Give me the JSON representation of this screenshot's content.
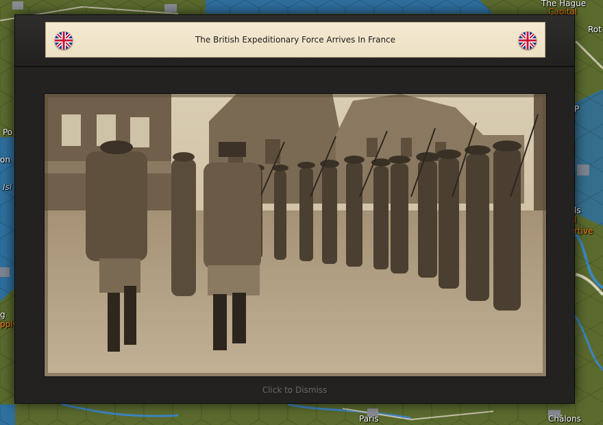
{
  "event_dialog": {
    "title": "The British Expeditionary Force Arrives In France",
    "flag_left_icon": "uk-flag-icon",
    "flag_right_icon": "uk-flag-icon",
    "photo_subject": "historical-photo-icon",
    "dismiss_label": "Click to Dismiss"
  },
  "map": {
    "labels": {
      "the_hague": "The Hague",
      "capital": "Capital",
      "rot": "Rot",
      "p_right": "P",
      "po_left": "Po",
      "on_left": "on",
      "isl_left": "Isl",
      "ls_right": "ls",
      "l_right": "l",
      "rtive_right": "rtive",
      "g_left": "g",
      "pply_left": "pply",
      "paris": "Paris",
      "chalons": "Châlons"
    }
  },
  "colors": {
    "terrain": "#5b6b2e",
    "water": "#2f6f9e",
    "river": "#3d86c4",
    "title_bar": "#f5ead2",
    "dialog": "#232221",
    "highlight_text": "#ff8a1a"
  }
}
